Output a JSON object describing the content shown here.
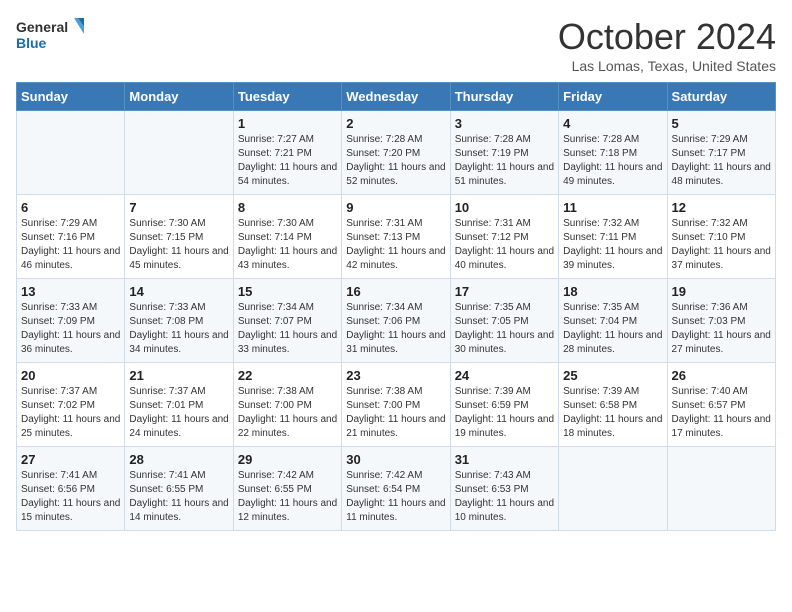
{
  "header": {
    "logo_line1": "General",
    "logo_line2": "Blue",
    "month_title": "October 2024",
    "location": "Las Lomas, Texas, United States"
  },
  "days_of_week": [
    "Sunday",
    "Monday",
    "Tuesday",
    "Wednesday",
    "Thursday",
    "Friday",
    "Saturday"
  ],
  "weeks": [
    [
      {
        "day": "",
        "sunrise": "",
        "sunset": "",
        "daylight": ""
      },
      {
        "day": "",
        "sunrise": "",
        "sunset": "",
        "daylight": ""
      },
      {
        "day": "1",
        "sunrise": "Sunrise: 7:27 AM",
        "sunset": "Sunset: 7:21 PM",
        "daylight": "Daylight: 11 hours and 54 minutes."
      },
      {
        "day": "2",
        "sunrise": "Sunrise: 7:28 AM",
        "sunset": "Sunset: 7:20 PM",
        "daylight": "Daylight: 11 hours and 52 minutes."
      },
      {
        "day": "3",
        "sunrise": "Sunrise: 7:28 AM",
        "sunset": "Sunset: 7:19 PM",
        "daylight": "Daylight: 11 hours and 51 minutes."
      },
      {
        "day": "4",
        "sunrise": "Sunrise: 7:28 AM",
        "sunset": "Sunset: 7:18 PM",
        "daylight": "Daylight: 11 hours and 49 minutes."
      },
      {
        "day": "5",
        "sunrise": "Sunrise: 7:29 AM",
        "sunset": "Sunset: 7:17 PM",
        "daylight": "Daylight: 11 hours and 48 minutes."
      }
    ],
    [
      {
        "day": "6",
        "sunrise": "Sunrise: 7:29 AM",
        "sunset": "Sunset: 7:16 PM",
        "daylight": "Daylight: 11 hours and 46 minutes."
      },
      {
        "day": "7",
        "sunrise": "Sunrise: 7:30 AM",
        "sunset": "Sunset: 7:15 PM",
        "daylight": "Daylight: 11 hours and 45 minutes."
      },
      {
        "day": "8",
        "sunrise": "Sunrise: 7:30 AM",
        "sunset": "Sunset: 7:14 PM",
        "daylight": "Daylight: 11 hours and 43 minutes."
      },
      {
        "day": "9",
        "sunrise": "Sunrise: 7:31 AM",
        "sunset": "Sunset: 7:13 PM",
        "daylight": "Daylight: 11 hours and 42 minutes."
      },
      {
        "day": "10",
        "sunrise": "Sunrise: 7:31 AM",
        "sunset": "Sunset: 7:12 PM",
        "daylight": "Daylight: 11 hours and 40 minutes."
      },
      {
        "day": "11",
        "sunrise": "Sunrise: 7:32 AM",
        "sunset": "Sunset: 7:11 PM",
        "daylight": "Daylight: 11 hours and 39 minutes."
      },
      {
        "day": "12",
        "sunrise": "Sunrise: 7:32 AM",
        "sunset": "Sunset: 7:10 PM",
        "daylight": "Daylight: 11 hours and 37 minutes."
      }
    ],
    [
      {
        "day": "13",
        "sunrise": "Sunrise: 7:33 AM",
        "sunset": "Sunset: 7:09 PM",
        "daylight": "Daylight: 11 hours and 36 minutes."
      },
      {
        "day": "14",
        "sunrise": "Sunrise: 7:33 AM",
        "sunset": "Sunset: 7:08 PM",
        "daylight": "Daylight: 11 hours and 34 minutes."
      },
      {
        "day": "15",
        "sunrise": "Sunrise: 7:34 AM",
        "sunset": "Sunset: 7:07 PM",
        "daylight": "Daylight: 11 hours and 33 minutes."
      },
      {
        "day": "16",
        "sunrise": "Sunrise: 7:34 AM",
        "sunset": "Sunset: 7:06 PM",
        "daylight": "Daylight: 11 hours and 31 minutes."
      },
      {
        "day": "17",
        "sunrise": "Sunrise: 7:35 AM",
        "sunset": "Sunset: 7:05 PM",
        "daylight": "Daylight: 11 hours and 30 minutes."
      },
      {
        "day": "18",
        "sunrise": "Sunrise: 7:35 AM",
        "sunset": "Sunset: 7:04 PM",
        "daylight": "Daylight: 11 hours and 28 minutes."
      },
      {
        "day": "19",
        "sunrise": "Sunrise: 7:36 AM",
        "sunset": "Sunset: 7:03 PM",
        "daylight": "Daylight: 11 hours and 27 minutes."
      }
    ],
    [
      {
        "day": "20",
        "sunrise": "Sunrise: 7:37 AM",
        "sunset": "Sunset: 7:02 PM",
        "daylight": "Daylight: 11 hours and 25 minutes."
      },
      {
        "day": "21",
        "sunrise": "Sunrise: 7:37 AM",
        "sunset": "Sunset: 7:01 PM",
        "daylight": "Daylight: 11 hours and 24 minutes."
      },
      {
        "day": "22",
        "sunrise": "Sunrise: 7:38 AM",
        "sunset": "Sunset: 7:00 PM",
        "daylight": "Daylight: 11 hours and 22 minutes."
      },
      {
        "day": "23",
        "sunrise": "Sunrise: 7:38 AM",
        "sunset": "Sunset: 7:00 PM",
        "daylight": "Daylight: 11 hours and 21 minutes."
      },
      {
        "day": "24",
        "sunrise": "Sunrise: 7:39 AM",
        "sunset": "Sunset: 6:59 PM",
        "daylight": "Daylight: 11 hours and 19 minutes."
      },
      {
        "day": "25",
        "sunrise": "Sunrise: 7:39 AM",
        "sunset": "Sunset: 6:58 PM",
        "daylight": "Daylight: 11 hours and 18 minutes."
      },
      {
        "day": "26",
        "sunrise": "Sunrise: 7:40 AM",
        "sunset": "Sunset: 6:57 PM",
        "daylight": "Daylight: 11 hours and 17 minutes."
      }
    ],
    [
      {
        "day": "27",
        "sunrise": "Sunrise: 7:41 AM",
        "sunset": "Sunset: 6:56 PM",
        "daylight": "Daylight: 11 hours and 15 minutes."
      },
      {
        "day": "28",
        "sunrise": "Sunrise: 7:41 AM",
        "sunset": "Sunset: 6:55 PM",
        "daylight": "Daylight: 11 hours and 14 minutes."
      },
      {
        "day": "29",
        "sunrise": "Sunrise: 7:42 AM",
        "sunset": "Sunset: 6:55 PM",
        "daylight": "Daylight: 11 hours and 12 minutes."
      },
      {
        "day": "30",
        "sunrise": "Sunrise: 7:42 AM",
        "sunset": "Sunset: 6:54 PM",
        "daylight": "Daylight: 11 hours and 11 minutes."
      },
      {
        "day": "31",
        "sunrise": "Sunrise: 7:43 AM",
        "sunset": "Sunset: 6:53 PM",
        "daylight": "Daylight: 11 hours and 10 minutes."
      },
      {
        "day": "",
        "sunrise": "",
        "sunset": "",
        "daylight": ""
      },
      {
        "day": "",
        "sunrise": "",
        "sunset": "",
        "daylight": ""
      }
    ]
  ]
}
